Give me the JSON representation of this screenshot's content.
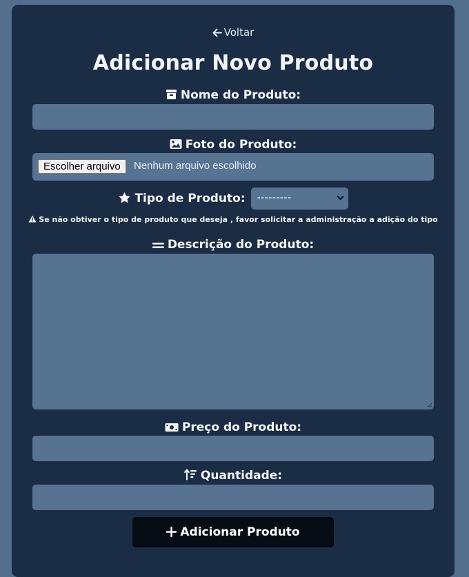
{
  "back_label": "Voltar",
  "title": "Adicionar Novo Produto",
  "fields": {
    "nome": {
      "label": "Nome do Produto:",
      "value": ""
    },
    "foto": {
      "label": "Foto do Produto:",
      "button_label": "Escolher arquivo",
      "status": "Nenhum arquivo escolhido"
    },
    "tipo": {
      "label": "Tipo de Produto:",
      "selected": "---------"
    },
    "tipo_warning": "Se não obtiver o tipo de produto que deseja , favor solicitar a administração a adição do tipo",
    "descricao": {
      "label": "Descrição do Produto:",
      "value": ""
    },
    "preco": {
      "label": "Preço do Produto:",
      "value": ""
    },
    "quantidade": {
      "label": "Quantidade:",
      "value": ""
    }
  },
  "submit_label": "Adicionar Produto",
  "colors": {
    "page_background": "#536e8d",
    "card_background": "#1a2d45",
    "input_background": "#567392",
    "button_background": "#050c14",
    "text": "#ffffff"
  },
  "icons": [
    "arrow-left-icon",
    "box-icon",
    "image-icon",
    "star-icon",
    "warning-icon",
    "equals-icon",
    "money-icon",
    "sort-amount-icon",
    "plus-icon"
  ]
}
